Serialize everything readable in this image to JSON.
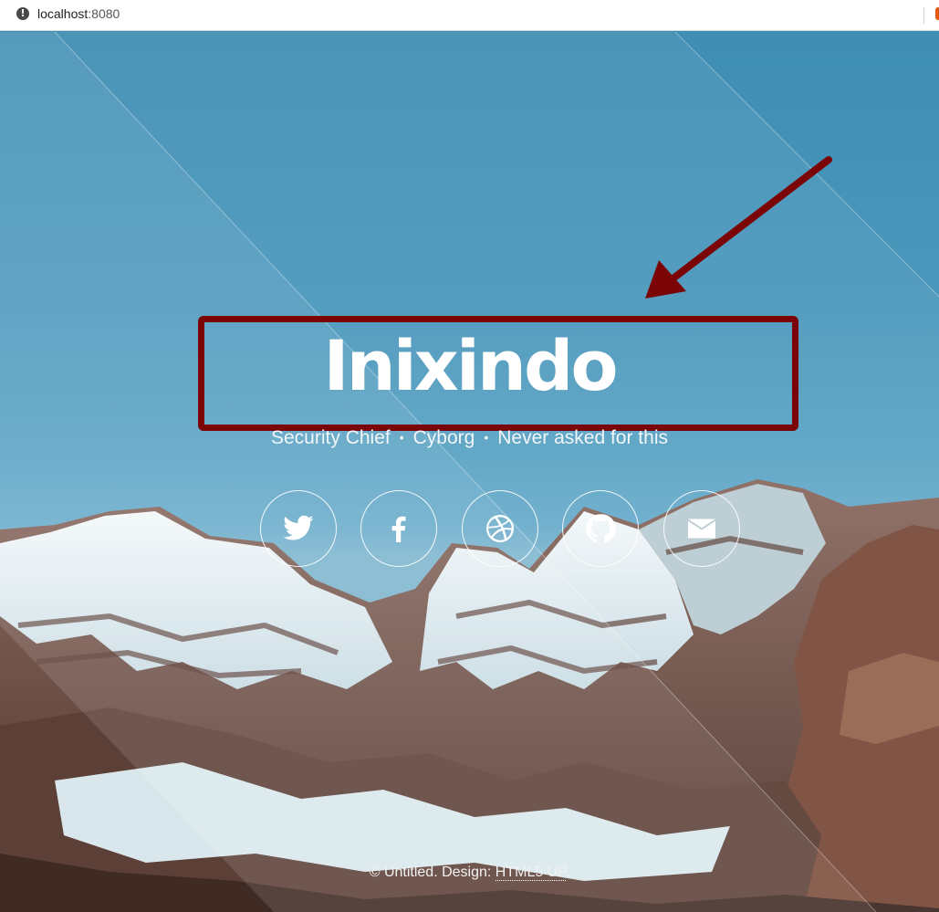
{
  "browser": {
    "url_host": "localhost",
    "url_port": ":8080"
  },
  "hero": {
    "title": "Inixindo",
    "tagline": [
      "Security Chief",
      "Cyborg",
      "Never asked for this"
    ],
    "tagline_separator": "•"
  },
  "socials": [
    {
      "name": "twitter-icon"
    },
    {
      "name": "facebook-icon"
    },
    {
      "name": "dribbble-icon"
    },
    {
      "name": "github-icon"
    },
    {
      "name": "email-icon"
    }
  ],
  "footer": {
    "prefix": "© Untitled. Design: ",
    "link": "HTML5 UP",
    "suffix": "."
  },
  "colors": {
    "annotation": "#7a0406",
    "sky": "#3f8eb3"
  }
}
